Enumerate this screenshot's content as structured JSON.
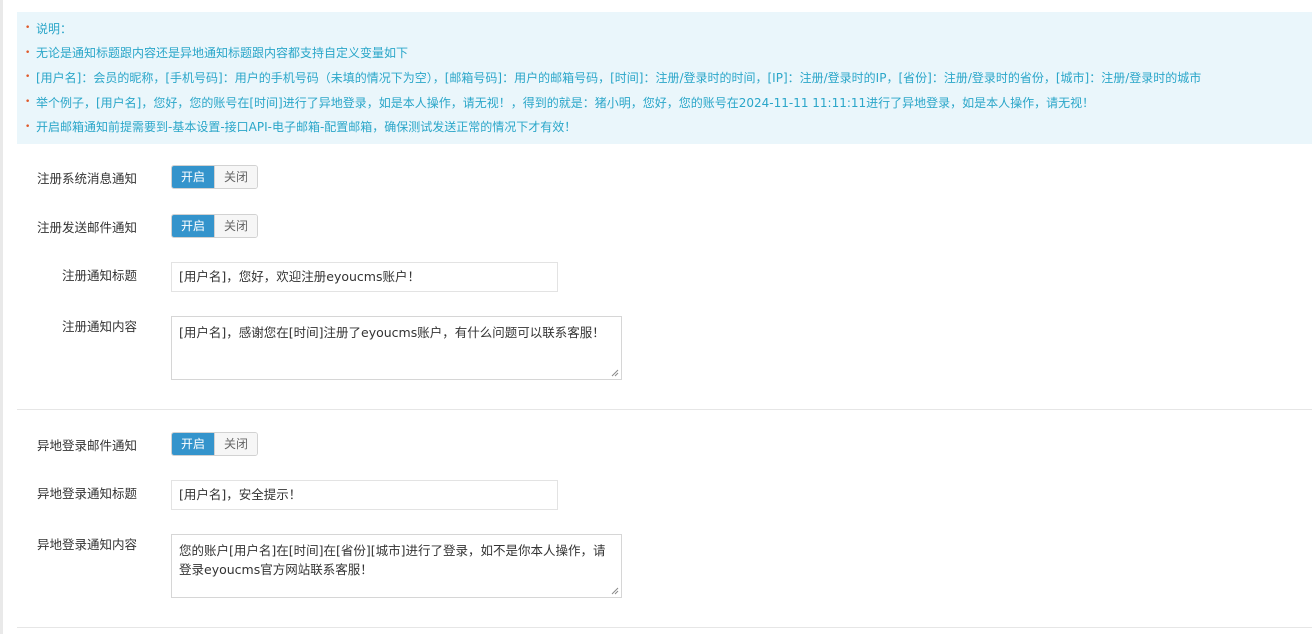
{
  "notice": {
    "lines": [
      "说明：",
      "无论是通知标题跟内容还是异地通知标题跟内容都支持自定义变量如下",
      "[用户名]：会员的昵称，[手机号码]：用户的手机号码（未填的情况下为空），[邮箱号码]：用户的邮箱号码，[时间]：注册/登录时的时间，[IP]：注册/登录时的IP，[省份]：注册/登录时的省份，[城市]：注册/登录时的城市",
      "举个例子，[用户名]，您好，您的账号在[时间]进行了异地登录，如是本人操作，请无视！，得到的就是：猪小明，您好，您的账号在2024-11-11 11:11:11进行了异地登录，如是本人操作，请无视！",
      "开启邮箱通知前提需要到-基本设置-接口API-电子邮箱-配置邮箱，确保测试发送正常的情况下才有效！"
    ]
  },
  "toggle_on_label": "开启",
  "toggle_off_label": "关闭",
  "register_system_notice": {
    "label": "注册系统消息通知",
    "state": "on"
  },
  "register_email_notice": {
    "label": "注册发送邮件通知",
    "state": "on"
  },
  "register_title": {
    "label": "注册通知标题",
    "value": "[用户名]，您好，欢迎注册eyoucms账户！"
  },
  "register_content": {
    "label": "注册通知内容",
    "value": "[用户名]，感谢您在[时间]注册了eyoucms账户，有什么问题可以联系客服！"
  },
  "remote_login_email_notice": {
    "label": "异地登录邮件通知",
    "state": "on"
  },
  "remote_login_title": {
    "label": "异地登录通知标题",
    "value": "[用户名]，安全提示！"
  },
  "remote_login_content": {
    "label": "异地登录通知内容",
    "value": "您的账户[用户名]在[时间]在[省份][城市]进行了登录，如不是你本人操作，请登录eyoucms官方网站联系客服！"
  },
  "colors": {
    "accent": "#3494cc",
    "notice_bg": "#eaf6fb",
    "notice_text": "#2aa6c9",
    "bullet": "#e05a2a"
  }
}
